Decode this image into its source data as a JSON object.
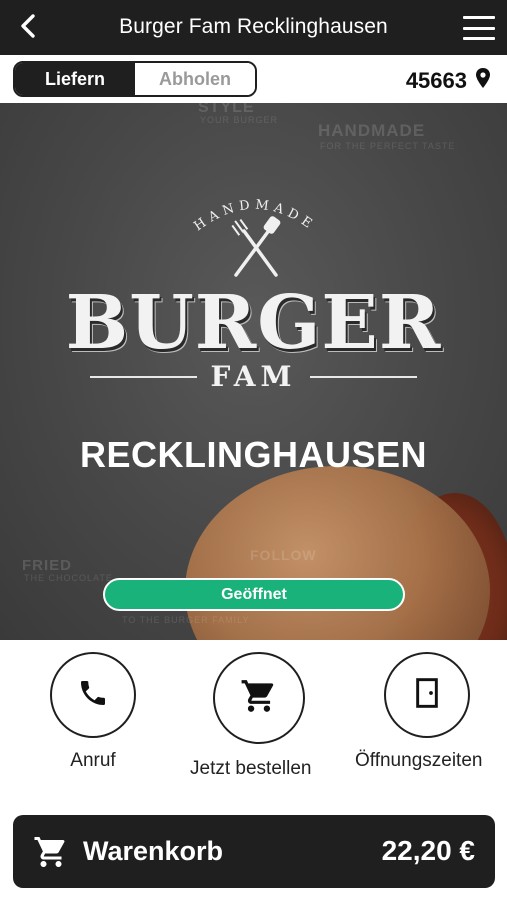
{
  "header": {
    "title": "Burger Fam Recklinghausen",
    "back_icon": "chevron-left-icon",
    "menu_icon": "hamburger-menu-icon"
  },
  "order_mode": {
    "delivery_label": "Liefern",
    "pickup_label": "Abholen",
    "selected": "Liefern"
  },
  "location": {
    "zip": "45663",
    "icon": "map-pin-icon"
  },
  "hero": {
    "logo_top": "HANDMADE",
    "logo_main": "BURGER",
    "logo_sub": "FAM",
    "city": "RECKLINGHAUSEN",
    "status": "Geöffnet",
    "status_color": "#19b27a"
  },
  "actions": [
    {
      "label": "Anruf",
      "icon": "phone-icon"
    },
    {
      "label": "Jetzt bestellen",
      "icon": "shopping-cart-icon"
    },
    {
      "label": "Öffnungszeiten",
      "icon": "door-icon"
    }
  ],
  "cart": {
    "label": "Warenkorb",
    "total": "22,20 €",
    "icon": "shopping-cart-icon"
  },
  "colors": {
    "dark": "#1f1f1f",
    "accent_green": "#19b27a"
  }
}
